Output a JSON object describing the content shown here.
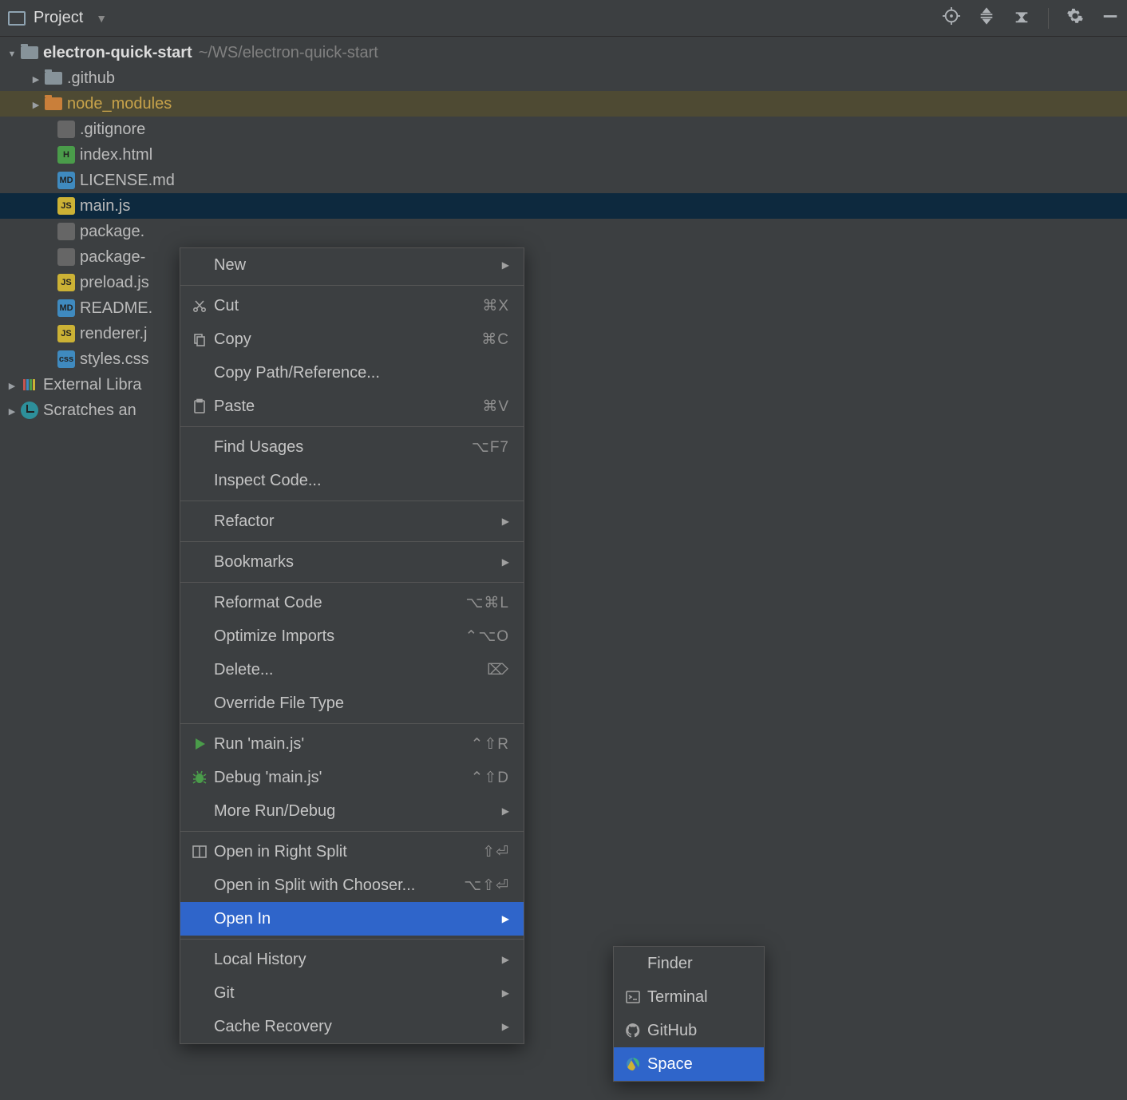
{
  "toolbar": {
    "title": "Project"
  },
  "tree": {
    "root": {
      "name": "electron-quick-start",
      "path": "~/WS/electron-quick-start"
    },
    "root_children": [
      {
        "name": ".github",
        "type": "folder",
        "expandable": true
      },
      {
        "name": "node_modules",
        "type": "folder-orange",
        "expandable": true,
        "highlight": true
      },
      {
        "name": ".gitignore",
        "type": "file"
      },
      {
        "name": "index.html",
        "type": "html"
      },
      {
        "name": "LICENSE.md",
        "type": "md"
      },
      {
        "name": "main.js",
        "type": "js",
        "selected": true
      },
      {
        "name": "package.",
        "type": "file"
      },
      {
        "name": "package-",
        "type": "file"
      },
      {
        "name": "preload.js",
        "type": "js"
      },
      {
        "name": "README.",
        "type": "md"
      },
      {
        "name": "renderer.j",
        "type": "js"
      },
      {
        "name": "styles.css",
        "type": "css"
      }
    ],
    "extras": [
      {
        "name": "External Libra",
        "icon": "lib"
      },
      {
        "name": "Scratches an",
        "icon": "scratch"
      }
    ]
  },
  "context_menu": [
    {
      "label": "New",
      "submenu": true
    },
    {
      "sep": true
    },
    {
      "label": "Cut",
      "shortcut": "⌘X",
      "icon": "cut"
    },
    {
      "label": "Copy",
      "shortcut": "⌘C",
      "icon": "copy"
    },
    {
      "label": "Copy Path/Reference..."
    },
    {
      "label": "Paste",
      "shortcut": "⌘V",
      "icon": "paste"
    },
    {
      "sep": true
    },
    {
      "label": "Find Usages",
      "shortcut": "⌥F7"
    },
    {
      "label": "Inspect Code..."
    },
    {
      "sep": true
    },
    {
      "label": "Refactor",
      "submenu": true
    },
    {
      "sep": true
    },
    {
      "label": "Bookmarks",
      "submenu": true
    },
    {
      "sep": true
    },
    {
      "label": "Reformat Code",
      "shortcut": "⌥⌘L"
    },
    {
      "label": "Optimize Imports",
      "shortcut": "⌃⌥O"
    },
    {
      "label": "Delete...",
      "shortcut": "⌦"
    },
    {
      "label": "Override File Type"
    },
    {
      "sep": true
    },
    {
      "label": "Run 'main.js'",
      "shortcut": "⌃⇧R",
      "icon": "run"
    },
    {
      "label": "Debug 'main.js'",
      "shortcut": "⌃⇧D",
      "icon": "debug"
    },
    {
      "label": "More Run/Debug",
      "submenu": true
    },
    {
      "sep": true
    },
    {
      "label": "Open in Right Split",
      "shortcut": "⇧⏎",
      "icon": "split"
    },
    {
      "label": "Open in Split with Chooser...",
      "shortcut": "⌥⇧⏎"
    },
    {
      "label": "Open In",
      "submenu": true,
      "highlight": true
    },
    {
      "sep": true
    },
    {
      "label": "Local History",
      "submenu": true
    },
    {
      "label": "Git",
      "submenu": true
    },
    {
      "label": "Cache Recovery",
      "submenu": true
    }
  ],
  "submenu": [
    {
      "label": "Finder",
      "icon": "none"
    },
    {
      "label": "Terminal",
      "icon": "terminal"
    },
    {
      "label": "GitHub",
      "icon": "github"
    },
    {
      "label": "Space",
      "icon": "space",
      "highlight": true
    }
  ]
}
